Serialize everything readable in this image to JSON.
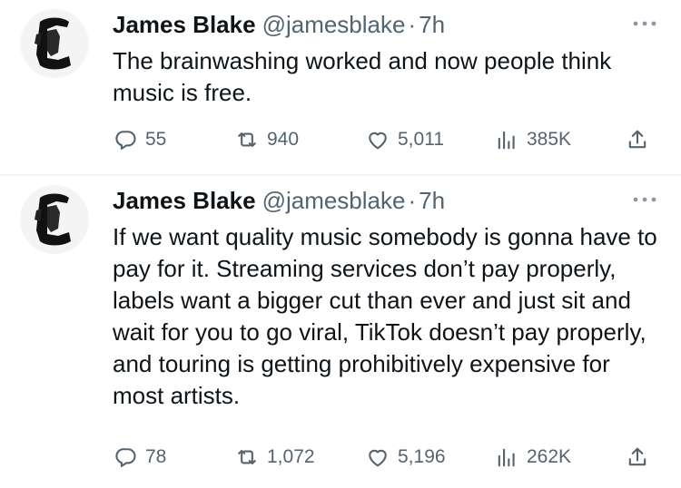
{
  "tweets": [
    {
      "author": {
        "name": "James Blake",
        "handle": "@jamesblake"
      },
      "separator": "·",
      "time": "7h",
      "text": "The brainwashing worked and now people think music is free.",
      "stats": {
        "replies": "55",
        "retweets": "940",
        "likes": "5,011",
        "views": "385K"
      }
    },
    {
      "author": {
        "name": "James Blake",
        "handle": "@jamesblake"
      },
      "separator": "·",
      "time": "7h",
      "text": "If we want quality music somebody is gonna have to pay for it. Streaming services don’t pay properly, labels want a bigger cut than ever and just sit and wait for you to go viral, TikTok doesn’t pay properly, and touring is getting prohibitively expensive for most artists.",
      "stats": {
        "replies": "78",
        "retweets": "1,072",
        "likes": "5,196",
        "views": "262K"
      }
    }
  ],
  "icons": {
    "reply": "reply-icon",
    "retweet": "retweet-icon",
    "like": "heart-icon",
    "views": "views-icon",
    "share": "share-icon",
    "more": "more-icon"
  },
  "colors": {
    "text": "#0f1419",
    "secondary": "#536471",
    "divider": "#eff3f4",
    "background": "#ffffff"
  }
}
